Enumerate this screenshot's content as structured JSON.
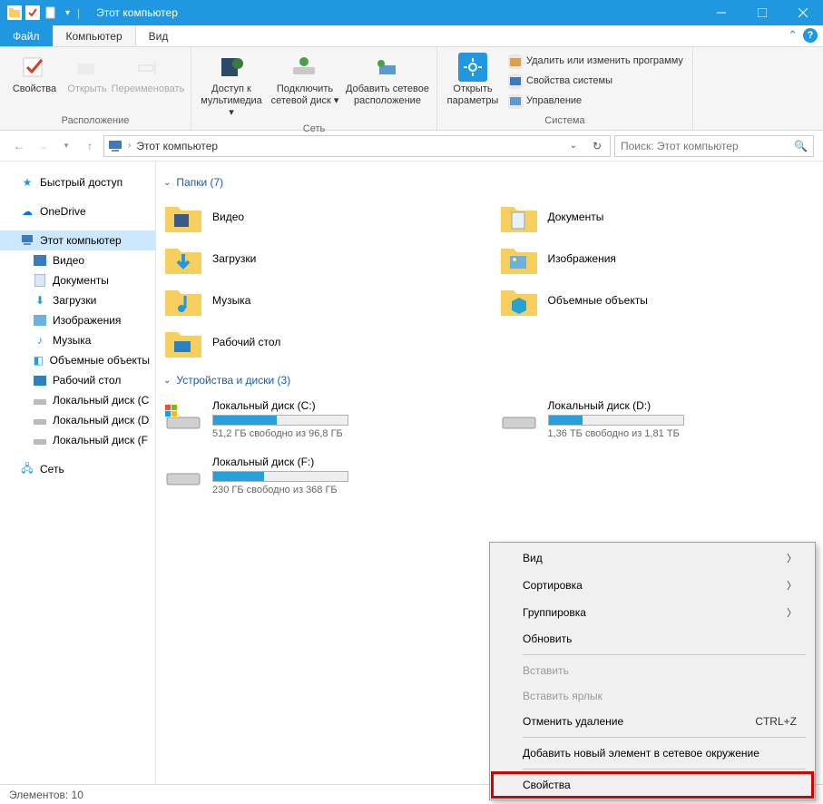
{
  "window": {
    "title": "Этот компьютер"
  },
  "tabs": {
    "file": "Файл",
    "computer": "Компьютер",
    "view": "Вид"
  },
  "ribbon": {
    "location_group": "Расположение",
    "network_group": "Сеть",
    "system_group": "Система",
    "properties": "Свойства",
    "open": "Открыть",
    "rename": "Переименовать",
    "media": "Доступ к мультимедиа ▾",
    "map_drive": "Подключить сетевой диск ▾",
    "add_net": "Добавить сетевое расположение",
    "open_settings": "Открыть параметры",
    "uninstall": "Удалить или изменить программу",
    "sys_props": "Свойства системы",
    "manage": "Управление"
  },
  "nav": {
    "crumb": "Этот компьютер",
    "search_placeholder": "Поиск: Этот компьютер"
  },
  "sidebar": {
    "quick": "Быстрый доступ",
    "onedrive": "OneDrive",
    "thispc": "Этот компьютер",
    "video": "Видео",
    "documents": "Документы",
    "downloads": "Загрузки",
    "pictures": "Изображения",
    "music": "Музыка",
    "objects3d": "Объемные объекты",
    "desktop": "Рабочий стол",
    "diskC": "Локальный диск (C",
    "diskD": "Локальный диск (D",
    "diskF": "Локальный диск (F",
    "network": "Сеть"
  },
  "sections": {
    "folders": "Папки (7)",
    "drives": "Устройства и диски (3)"
  },
  "folders": [
    {
      "label": "Видео",
      "icon": "video"
    },
    {
      "label": "Документы",
      "icon": "documents"
    },
    {
      "label": "Загрузки",
      "icon": "downloads"
    },
    {
      "label": "Изображения",
      "icon": "pictures"
    },
    {
      "label": "Музыка",
      "icon": "music"
    },
    {
      "label": "Объемные объекты",
      "icon": "objects3d"
    },
    {
      "label": "Рабочий стол",
      "icon": "desktop"
    }
  ],
  "drives": [
    {
      "name": "Локальный диск (C:)",
      "free": "51,2 ГБ свободно из 96,8 ГБ",
      "fill": 47
    },
    {
      "name": "Локальный диск (D:)",
      "free": "1,36 ТБ свободно из 1,81 ТБ",
      "fill": 25
    },
    {
      "name": "Локальный диск (F:)",
      "free": "230 ГБ свободно из 368 ГБ",
      "fill": 38
    }
  ],
  "status": {
    "items": "Элементов: 10"
  },
  "ctx": {
    "view": "Вид",
    "sort": "Сортировка",
    "group": "Группировка",
    "refresh": "Обновить",
    "paste": "Вставить",
    "paste_shortcut": "Вставить ярлык",
    "undo": "Отменить удаление",
    "undo_key": "CTRL+Z",
    "add_net": "Добавить новый элемент в сетевое окружение",
    "properties": "Свойства"
  }
}
